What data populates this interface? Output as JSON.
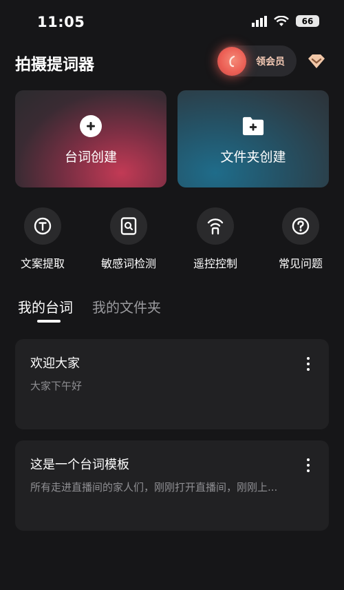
{
  "status_bar": {
    "time": "11:05",
    "battery": "66"
  },
  "header": {
    "title": "拍摄提词器",
    "vip_label": "领会员"
  },
  "create_cards": [
    {
      "label": "台词创建",
      "icon": "plus-circle-icon"
    },
    {
      "label": "文件夹创建",
      "icon": "folder-plus-icon"
    }
  ],
  "tools": [
    {
      "label": "文案提取",
      "icon": "text-extract-icon"
    },
    {
      "label": "敏感词检测",
      "icon": "sensitive-search-icon"
    },
    {
      "label": "遥控控制",
      "icon": "remote-signal-icon"
    },
    {
      "label": "常见问题",
      "icon": "question-icon"
    }
  ],
  "tabs": [
    {
      "label": "我的台词",
      "active": true
    },
    {
      "label": "我的文件夹",
      "active": false
    }
  ],
  "scripts": [
    {
      "title": "欢迎大家",
      "preview": "大家下午好"
    },
    {
      "title": "这是一个台词模板",
      "preview": "所有走进直播间的家人们，刚刚打开直播间，刚刚上..."
    }
  ],
  "colors": {
    "background": "#161618",
    "card": "#212123",
    "vip_accent": "#ec5f55"
  }
}
